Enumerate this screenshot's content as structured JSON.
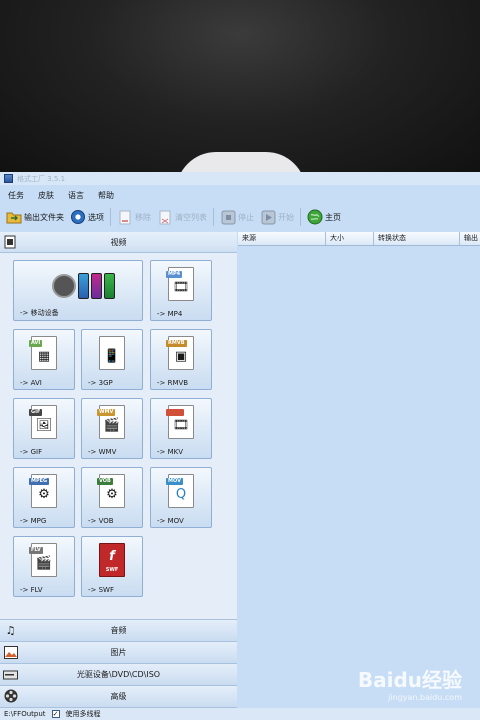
{
  "window": {
    "title": "格式工厂 3.5.1"
  },
  "menu": [
    "任务",
    "皮肤",
    "语言",
    "帮助"
  ],
  "toolbar": {
    "output_folder": "输出文件夹",
    "options": "选项",
    "remove": "移除",
    "clear_list": "清空列表",
    "stop": "停止",
    "start": "开始",
    "home": "主页"
  },
  "categories": {
    "video": "视频",
    "audio": "音频",
    "picture": "图片",
    "rom": "光驱设备\\DVD\\CD\\ISO",
    "advanced": "高级"
  },
  "video_formats": [
    {
      "label": "-> 移动设备",
      "icon": "mobile-device-icon",
      "tag": ""
    },
    {
      "label": "-> MP4",
      "icon": "mp4-file-icon",
      "tag": "MP4",
      "color": "#5b8fcf"
    },
    {
      "label": "-> AVI",
      "icon": "avi-file-icon",
      "tag": "AVI",
      "color": "#6aa84f"
    },
    {
      "label": "-> 3GP",
      "icon": "3gp-file-icon",
      "tag": "",
      "color": "#4b9a3a"
    },
    {
      "label": "-> RMVB",
      "icon": "rmvb-file-icon",
      "tag": "RMVB",
      "color": "#c58b2a"
    },
    {
      "label": "-> GIF",
      "icon": "gif-file-icon",
      "tag": "GIF",
      "color": "#444444"
    },
    {
      "label": "-> WMV",
      "icon": "wmv-file-icon",
      "tag": "WMV",
      "color": "#c9962f"
    },
    {
      "label": "-> MKV",
      "icon": "mkv-file-icon",
      "tag": "",
      "color": "#d0503a"
    },
    {
      "label": "-> MPG",
      "icon": "mpg-file-icon",
      "tag": "MPEG",
      "color": "#3f6fb0"
    },
    {
      "label": "-> VOB",
      "icon": "vob-file-icon",
      "tag": "VOB",
      "color": "#3b7d3b"
    },
    {
      "label": "-> MOV",
      "icon": "mov-file-icon",
      "tag": "MOV",
      "color": "#3a8fc8"
    },
    {
      "label": "-> FLV",
      "icon": "flv-file-icon",
      "tag": "FLV",
      "color": "#777777"
    },
    {
      "label": "-> SWF",
      "icon": "swf-file-icon",
      "tag": "SWF",
      "color": "#c0282a"
    }
  ],
  "task_columns": [
    "来源",
    "大小",
    "转换状态",
    "输出"
  ],
  "status": {
    "output_path": "E:\\FFOutput",
    "multithread": "使用多线程"
  },
  "watermark": {
    "logo": "Baidu经验",
    "url": "jingyan.baidu.com"
  }
}
